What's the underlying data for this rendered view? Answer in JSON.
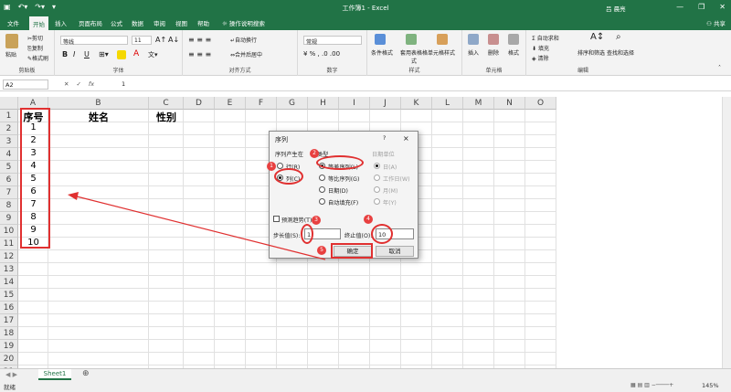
{
  "colors": {
    "brand": "#217346",
    "annotation": "#e03030"
  },
  "title_bar": {
    "title": "工作簿1 - Excel",
    "user": "吕 晨亮",
    "quick_access": [
      "save-icon",
      "undo-icon",
      "redo-icon",
      "customize-icon"
    ],
    "window_controls": [
      "minimize-icon",
      "restore-icon",
      "close-icon"
    ]
  },
  "menu": {
    "tabs": [
      "文件",
      "开始",
      "插入",
      "页面布局",
      "公式",
      "数据",
      "审阅",
      "视图",
      "帮助"
    ],
    "active": "开始",
    "search": "操作说明搜索",
    "share": "共享"
  },
  "ribbon": {
    "clipboard": {
      "label": "剪贴板",
      "paste": "粘贴",
      "cut": "剪切",
      "copy": "复制",
      "format_painter": "格式刷"
    },
    "font": {
      "label": "字体",
      "name": "等线",
      "size": "11",
      "bold": "B",
      "italic": "I",
      "underline": "U"
    },
    "alignment": {
      "label": "对齐方式",
      "wrap": "自动换行",
      "merge": "合并后居中"
    },
    "number": {
      "label": "数字",
      "format": "常规"
    },
    "styles": {
      "label": "样式",
      "conditional": "条件格式",
      "table": "套用表格格式",
      "cell_styles": "单元格样式"
    },
    "cells": {
      "label": "单元格",
      "insert": "插入",
      "delete": "删除",
      "format": "格式"
    },
    "editing": {
      "label": "编辑",
      "autosum": "自动求和",
      "fill": "填充",
      "clear": "清除",
      "sort": "排序和筛选",
      "find": "查找和选择"
    }
  },
  "formula_bar": {
    "name_box": "A2",
    "value": "1",
    "icons": [
      "cancel-icon",
      "enter-icon",
      "fx-icon"
    ]
  },
  "sheet": {
    "columns": [
      "A",
      "B",
      "C",
      "D",
      "E",
      "F",
      "G",
      "H",
      "I",
      "J",
      "K",
      "L",
      "M",
      "N",
      "O"
    ],
    "rows": [
      "1",
      "2",
      "3",
      "4",
      "5",
      "6",
      "7",
      "8",
      "9",
      "10",
      "11",
      "12",
      "13",
      "14",
      "15",
      "16",
      "17",
      "18",
      "19",
      "20",
      "21"
    ],
    "headers": [
      "序号",
      "姓名",
      "性别"
    ],
    "seq": [
      "1",
      "2",
      "3",
      "4",
      "5",
      "6",
      "7",
      "8",
      "9",
      "10"
    ]
  },
  "dialog": {
    "title": "序列",
    "help": "?",
    "close": "×",
    "series_in_label": "序列产生在",
    "series_in": [
      "行(R)",
      "列(C)"
    ],
    "type_label": "类型",
    "types": [
      "等差序列(L)",
      "等比序列(G)",
      "日期(D)",
      "自动填充(F)"
    ],
    "date_unit_label": "日期单位",
    "date_units": [
      "日(A)",
      "工作日(W)",
      "月(M)",
      "年(Y)"
    ],
    "trend": "预测趋势(T)",
    "step_label": "步长值(S):",
    "step_value": "1",
    "stop_label": "终止值(O):",
    "stop_value": "10",
    "ok": "确定",
    "cancel": "取消"
  },
  "annotations": [
    "1",
    "2",
    "3",
    "4",
    "5"
  ],
  "sheet_tab": "Sheet1",
  "add_sheet": "⊕",
  "status": {
    "ready": "就绪",
    "zoom": "145%"
  }
}
